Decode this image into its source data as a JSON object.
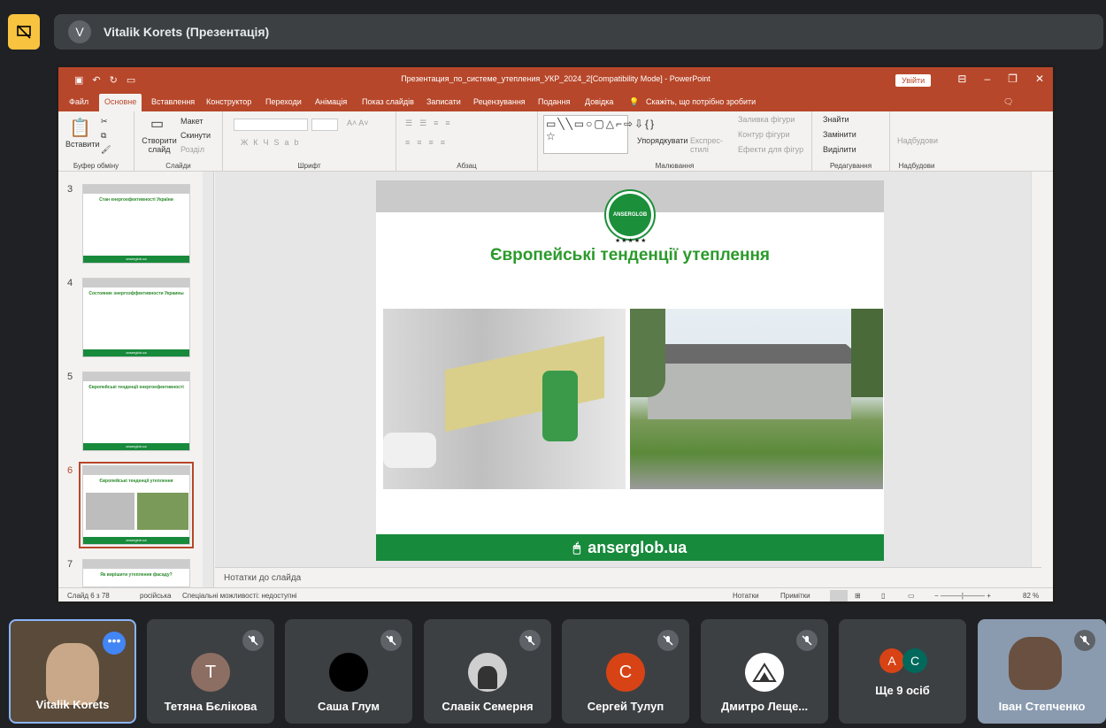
{
  "meet": {
    "presenter_initial": "V",
    "presenter_title": "Vitalik Korets (Презентація)"
  },
  "ppt": {
    "doc_title": "Презентация_по_системе_утепления_УКР_2024_2[Compatibility Mode]  -  PowerPoint",
    "signin": "Увійти",
    "tabs": [
      "Файл",
      "Основне",
      "Вставлення",
      "Конструктор",
      "Переходи",
      "Анімація",
      "Показ слайдів",
      "Записати",
      "Рецензування",
      "Подання",
      "Довідка"
    ],
    "tell_me": "Скажіть, що потрібно зробити",
    "ribbon": {
      "paste": "Вставити",
      "clipboard": "Буфер обміну",
      "new_slide": "Створити слайд",
      "layout": "Макет",
      "reset": "Скинути",
      "section": "Розділ",
      "slides": "Слайди",
      "font": "Шрифт",
      "paragraph": "Абзац",
      "arrange": "Упорядкувати",
      "quick_styles": "Експрес-стилі",
      "shape_fill": "Заливка фігури",
      "shape_outline": "Контур фігури",
      "shape_effects": "Ефекти для фігур",
      "drawing": "Малювання",
      "find": "Знайти",
      "replace": "Замінити",
      "select": "Виділити",
      "editing": "Редагування",
      "addins": "Надбудови",
      "addins_group": "Надбудови"
    },
    "thumbnails": [
      {
        "num": "3",
        "title": "Стан енергоефективності України"
      },
      {
        "num": "4",
        "title": "Состояние энергоэффективности Украины"
      },
      {
        "num": "5",
        "title": "Європейські тенденції енергоефективності"
      },
      {
        "num": "6",
        "title": "Європейські тенденції утеплення"
      },
      {
        "num": "7",
        "title": "Як вирішити утеплення фасаду?"
      }
    ],
    "thumb_footer": "anserglob.ua",
    "slide": {
      "logo_text": "ANSERGLOB",
      "stars": "★★★★★",
      "title": "Європейські тенденції утеплення",
      "footer": "anserglob.ua"
    },
    "notes": "Нотатки до слайда",
    "status": {
      "slide_count": "Слайд 6 з 78",
      "language": "російська",
      "accessibility": "Спеціальні можливості: недоступні",
      "notes_btn": "Нотатки",
      "comments_btn": "Примітки",
      "zoom": "82 %"
    }
  },
  "participants": [
    {
      "name": "Vitalik Korets",
      "type": "video"
    },
    {
      "name": "Тетяна Бєлікова",
      "initial": "T",
      "color": "#8d6e63"
    },
    {
      "name": "Саша Глум",
      "initial": "",
      "color": "#000000"
    },
    {
      "name": "Славік Семерня",
      "initial": "",
      "color": "#cfcfcf"
    },
    {
      "name": "Сергей Тулуп",
      "initial": "C",
      "color": "#d84315"
    },
    {
      "name": "Дмитро Леще...",
      "initial": "",
      "color": "#ffffff"
    },
    {
      "name": "Ще 9 осіб",
      "initials": [
        "A",
        "C"
      ]
    },
    {
      "name": "Іван Степченко",
      "type": "video"
    }
  ]
}
